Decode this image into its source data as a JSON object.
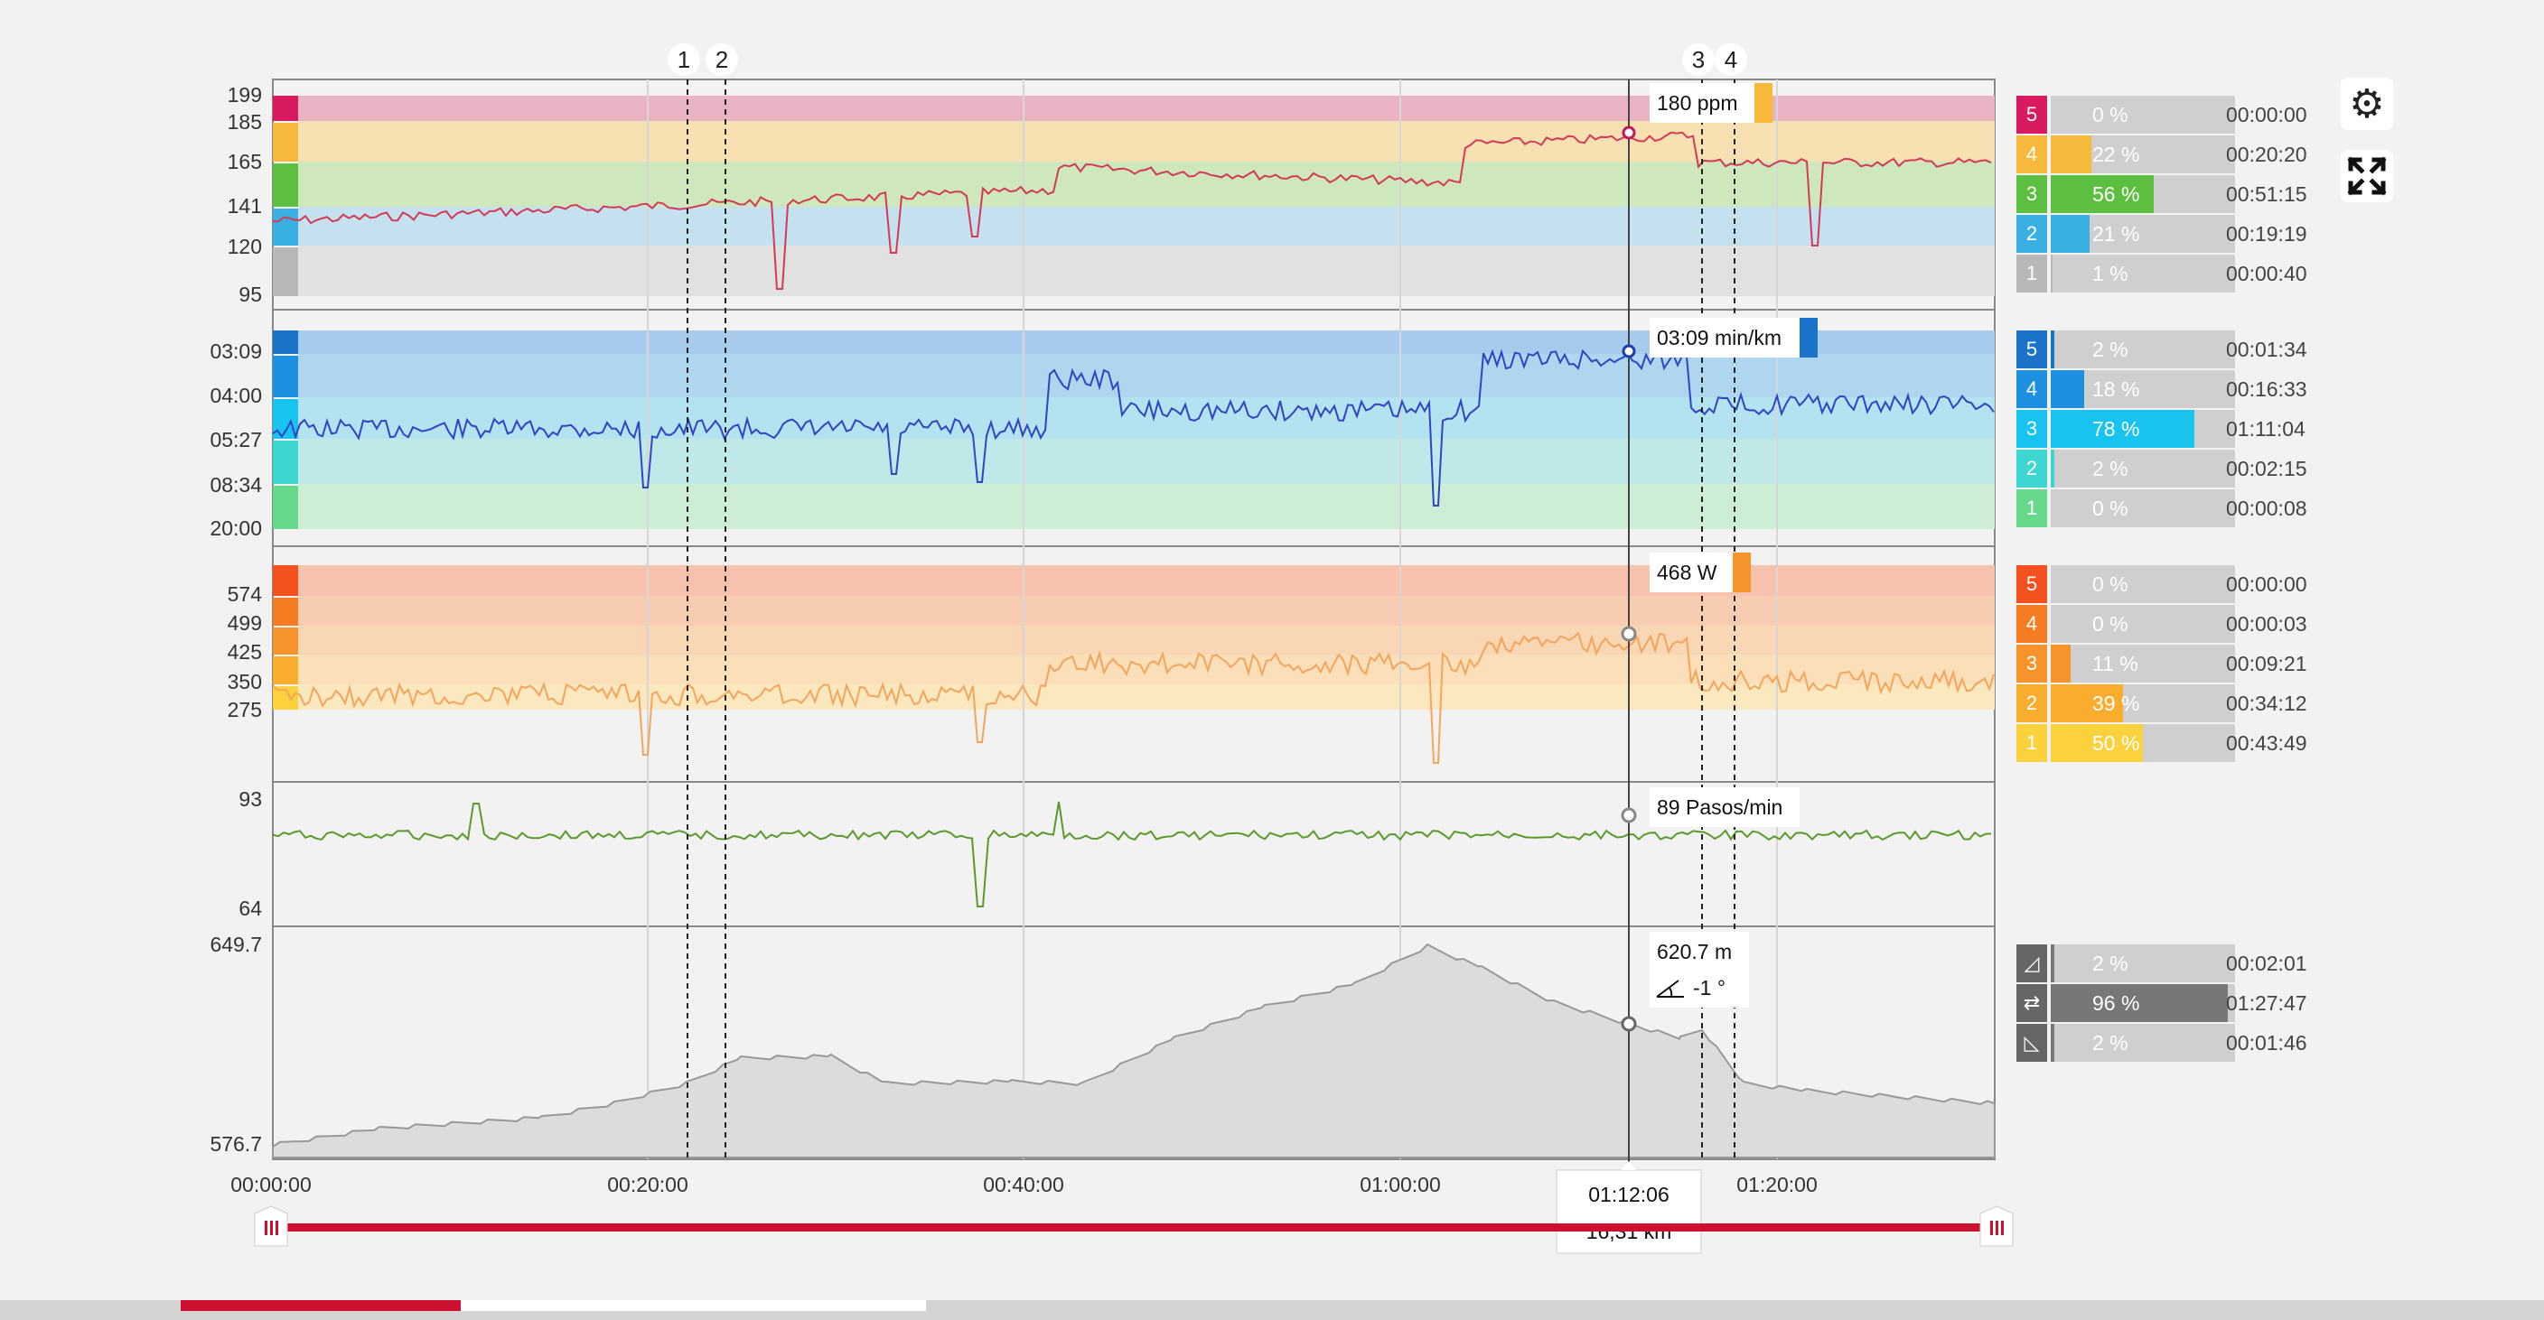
{
  "colors": {
    "hr_line": "#d43a55",
    "pace_line": "#2f45c4",
    "power_line": "#f5a45a",
    "cadence_line": "#5a9a2a",
    "elev_fill": "#dcdcdc",
    "slider": "#cc1030"
  },
  "markers": [
    "1",
    "2",
    "3",
    "4"
  ],
  "tooltips": {
    "hr": "180 ppm",
    "pace": "03:09 min/km",
    "power": "468 W",
    "cadence": "89 Pasos/min",
    "elevation": "620.7 m",
    "slope": "-1 °",
    "time": "01:12:06",
    "distance": "16,31 km"
  },
  "panels": {
    "hr": {
      "ticks": [
        "199",
        "185",
        "165",
        "141",
        "120",
        "95"
      ]
    },
    "pace": {
      "ticks": [
        "03:09",
        "04:00",
        "05:27",
        "08:34",
        "20:00"
      ]
    },
    "power": {
      "ticks": [
        "574",
        "499",
        "425",
        "350",
        "275"
      ]
    },
    "cadence": {
      "ticks": [
        "93",
        "64"
      ]
    },
    "elevation": {
      "ticks": [
        "649.7",
        "576.7"
      ]
    }
  },
  "x_axis": [
    "00:00:00",
    "00:20:00",
    "00:40:00",
    "01:00:00",
    "01:20:00"
  ],
  "zones": {
    "hr": [
      {
        "n": "5",
        "pct": "0 %",
        "frac": 0.0,
        "time": "00:00:00",
        "color": "#d81b60"
      },
      {
        "n": "4",
        "pct": "22 %",
        "frac": 0.22,
        "time": "00:20:20",
        "color": "#f6b93b"
      },
      {
        "n": "3",
        "pct": "56 %",
        "frac": 0.56,
        "time": "00:51:15",
        "color": "#5cbf3f"
      },
      {
        "n": "2",
        "pct": "21 %",
        "frac": 0.21,
        "time": "00:19:19",
        "color": "#3ab0e2"
      },
      {
        "n": "1",
        "pct": "1 %",
        "frac": 0.01,
        "time": "00:00:40",
        "color": "#b8b8b8"
      }
    ],
    "pace": [
      {
        "n": "5",
        "pct": "2 %",
        "frac": 0.02,
        "time": "00:01:34",
        "color": "#1a73c8"
      },
      {
        "n": "4",
        "pct": "18 %",
        "frac": 0.18,
        "time": "00:16:33",
        "color": "#1e90e0"
      },
      {
        "n": "3",
        "pct": "78 %",
        "frac": 0.78,
        "time": "01:11:04",
        "color": "#19c3ef"
      },
      {
        "n": "2",
        "pct": "2 %",
        "frac": 0.02,
        "time": "00:02:15",
        "color": "#3ed6d0"
      },
      {
        "n": "1",
        "pct": "0 %",
        "frac": 0.0,
        "time": "00:00:08",
        "color": "#66d98c"
      }
    ],
    "power": [
      {
        "n": "5",
        "pct": "0 %",
        "frac": 0.0,
        "time": "00:00:00",
        "color": "#f4511e"
      },
      {
        "n": "4",
        "pct": "0 %",
        "frac": 0.0,
        "time": "00:00:03",
        "color": "#f57c22"
      },
      {
        "n": "3",
        "pct": "11 %",
        "frac": 0.11,
        "time": "00:09:21",
        "color": "#f7932b"
      },
      {
        "n": "2",
        "pct": "39 %",
        "frac": 0.39,
        "time": "00:34:12",
        "color": "#f9ad2e"
      },
      {
        "n": "1",
        "pct": "50 %",
        "frac": 0.5,
        "time": "00:43:49",
        "color": "#fbd23e"
      }
    ],
    "slope": [
      {
        "icon": "uphill-icon",
        "pct": "2 %",
        "frac": 0.02,
        "time": "00:02:01"
      },
      {
        "icon": "flat-icon",
        "pct": "96 %",
        "frac": 0.96,
        "time": "01:27:47"
      },
      {
        "icon": "downhill-icon",
        "pct": "2 %",
        "frac": 0.02,
        "time": "00:01:46"
      }
    ]
  },
  "toolbar": {
    "settings_icon": "gear-icon",
    "fullscreen_icon": "fullscreen-icon"
  }
}
